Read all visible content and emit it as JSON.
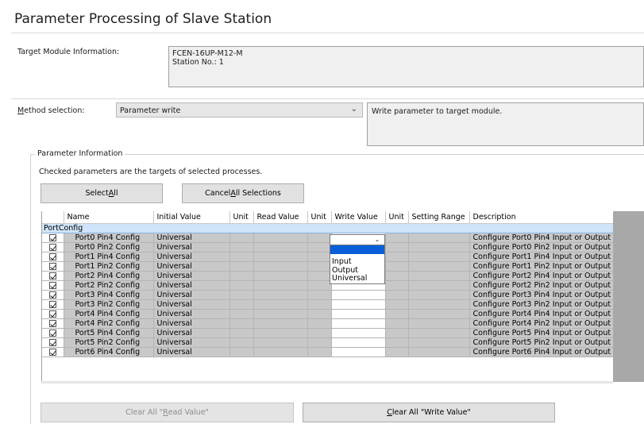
{
  "title": "Parameter Processing of Slave Station",
  "target_module": {
    "label": "Target Module Information:",
    "line1": "FCEN-16UP-M12-M",
    "line2": "Station No.: 1"
  },
  "method": {
    "label": "Method selection:",
    "value": "Parameter write",
    "description": "Write parameter to target module."
  },
  "param_info": {
    "group_label": "Parameter Information",
    "note": "Checked parameters are the targets of selected processes.",
    "select_all": "Select All",
    "cancel_all": "Cancel All Selections"
  },
  "grid": {
    "headers": [
      "",
      "Name",
      "Initial Value",
      "Unit",
      "Read Value",
      "Unit",
      "Write Value",
      "Unit",
      "Setting Range",
      "Description"
    ],
    "group": "PortConfig",
    "rows": [
      {
        "name": "Port0 Pin4 Config",
        "initial": "Universal",
        "desc": "Configure Port0 Pin4 Input or Output"
      },
      {
        "name": "Port0 Pin2 Config",
        "initial": "Universal",
        "desc": "Configure Port0 Pin2 Input or Output"
      },
      {
        "name": "Port1 Pin4 Config",
        "initial": "Universal",
        "desc": "Configure Port1 Pin4 Input or Output"
      },
      {
        "name": "Port1 Pin2 Config",
        "initial": "Universal",
        "desc": "Configure Port1 Pin2 Input or Output"
      },
      {
        "name": "Port2 Pin4 Config",
        "initial": "Universal",
        "desc": "Configure Port2 Pin4 Input or Output"
      },
      {
        "name": "Port2 Pin2 Config",
        "initial": "Universal",
        "desc": "Configure Port2 Pin2 Input or Output"
      },
      {
        "name": "Port3 Pin4 Config",
        "initial": "Universal",
        "desc": "Configure Port3 Pin4 Input or Output"
      },
      {
        "name": "Port3 Pin2 Config",
        "initial": "Universal",
        "desc": "Configure Port3 Pin2 Input or Output"
      },
      {
        "name": "Port4 Pin4 Config",
        "initial": "Universal",
        "desc": "Configure Port4 Pin4 Input or Output"
      },
      {
        "name": "Port4 Pin2 Config",
        "initial": "Universal",
        "desc": "Configure Port4 Pin2 Input or Output"
      },
      {
        "name": "Port5 Pin4 Config",
        "initial": "Universal",
        "desc": "Configure Port5 Pin4 Input or Output"
      },
      {
        "name": "Port5 Pin2 Config",
        "initial": "Universal",
        "desc": "Configure Port5 Pin2 Input or Output"
      },
      {
        "name": "Port6 Pin4 Config",
        "initial": "Universal",
        "desc": "Configure Port6 Pin4 Input or Output"
      }
    ]
  },
  "dropdown": {
    "options": [
      "Input",
      "Output",
      "Universal"
    ]
  },
  "bottom": {
    "clear_read": "Clear All \"Read Value\"",
    "clear_write": "Clear All \"Write Value\""
  },
  "colors": {
    "group_row": "#cfe4f8",
    "highlight": "#0a5fd8",
    "cell_gray": "#c8c8c8"
  }
}
